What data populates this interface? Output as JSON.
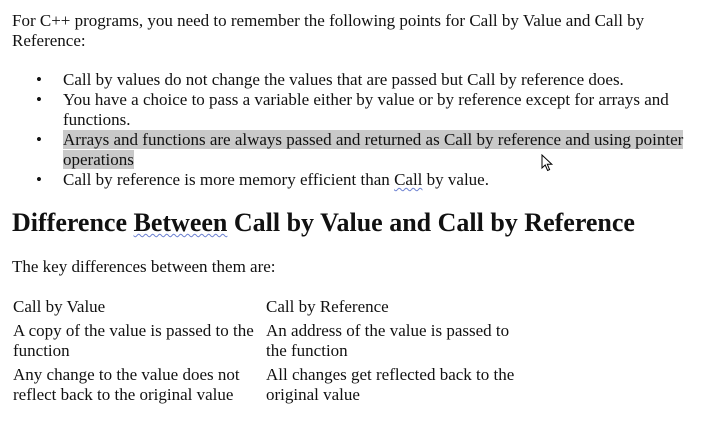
{
  "intro": "For C++ programs, you need to remember the following points for Call by Value and Call by Reference:",
  "bullet_glyph": "•",
  "bullets": [
    {
      "text": "Call by values do not change the values that are passed but Call by reference does."
    },
    {
      "text": "You have a choice to pass a variable either by value or by reference except for arrays and functions."
    },
    {
      "text": "Arrays and functions are always passed and returned as Call by reference and using pointer operations "
    },
    {
      "before": "Call by reference is more memory efficient than ",
      "squiggle": "Call",
      "after": " by value."
    }
  ],
  "heading": {
    "part1": "Difference ",
    "squiggle": "Between",
    "part2": " Call by Value and Call by Reference"
  },
  "subtitle": "The key differences between them are:",
  "table": {
    "headers": [
      "Call by Value",
      "Call by Reference"
    ],
    "rows": [
      [
        "A copy of the value is passed to the function",
        "An address of the value is passed to the function"
      ],
      [
        "Any change to the value does not reflect back to the original value",
        "All changes get reflected back to the original value"
      ]
    ]
  },
  "colors": {
    "selection_highlight": "#c9c9c9",
    "spellcheck_underline": "#6a7fd0"
  }
}
